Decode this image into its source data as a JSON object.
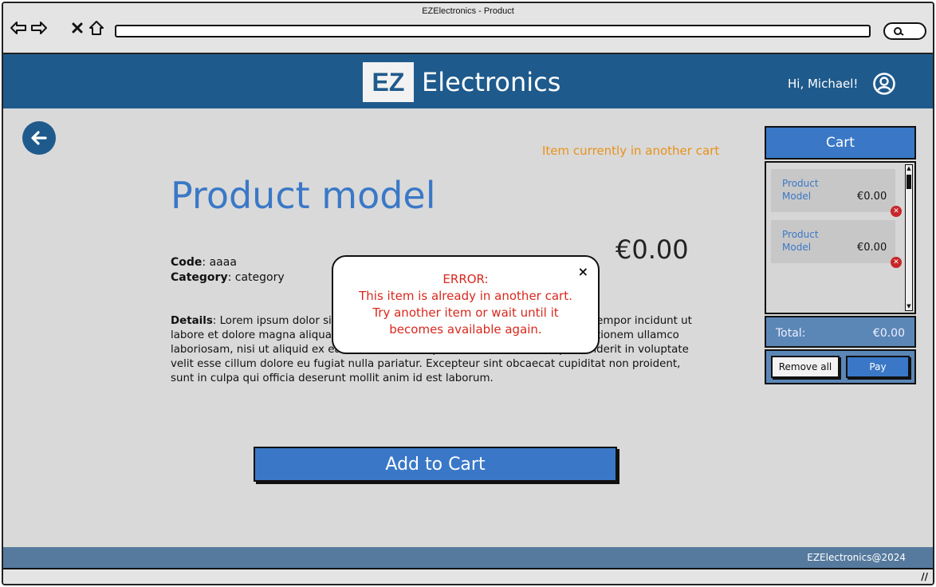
{
  "window": {
    "title": "EZElectronics - Product"
  },
  "header": {
    "logo_mark": "EZ",
    "logo_text": "Electronics",
    "greeting": "Hi, Michael!"
  },
  "product": {
    "status_warning": "Item currently in another cart",
    "title": "Product model",
    "price": "€0.00",
    "code_label": "Code",
    "code_value": ": aaaa",
    "category_label": "Category",
    "category_value": ": category",
    "details_label": "Details",
    "details_value": ": Lorem ipsum dolor sit amet, consectetur adipiscing elit, sed eiusmod tempor incidunt ut labore et dolore magna aliqua. Ut enim ad minim veniam, quis nostrud exercitationem ullamco laboriosam, nisi ut aliquid ex ea commodi consequatur. Quis aute iure reprehenderit in voluptate velit esse cillum dolore eu fugiat nulla pariatur. Excepteur sint obcaecat cupiditat non proident, sunt in culpa qui officia deserunt mollit anim id est laborum.",
    "add_to_cart_label": "Add to Cart"
  },
  "modal": {
    "line1": "ERROR:",
    "line2": "This item is already in another cart.",
    "line3": "Try another item or wait until it",
    "line4": "becomes available again.",
    "close_glyph": "×"
  },
  "cart": {
    "title": "Cart",
    "items": [
      {
        "name": "Product Model",
        "price": "€0.00"
      },
      {
        "name": "Product Model",
        "price": "€0.00"
      }
    ],
    "total_label": "Total:",
    "total_value": "€0.00",
    "remove_all_label": "Remove all",
    "pay_label": "Pay"
  },
  "footer": {
    "text": "EZElectronics@2024"
  },
  "colors": {
    "brand": "#1f5a8c",
    "accent": "#3a78c7",
    "warning": "#e8921a",
    "error": "#d8281e"
  },
  "icons": [
    "back-arrow-icon",
    "forward-arrow-icon",
    "close-icon",
    "home-icon",
    "search-icon",
    "user-icon",
    "left-arrow-icon",
    "remove-icon",
    "resize-icon"
  ]
}
